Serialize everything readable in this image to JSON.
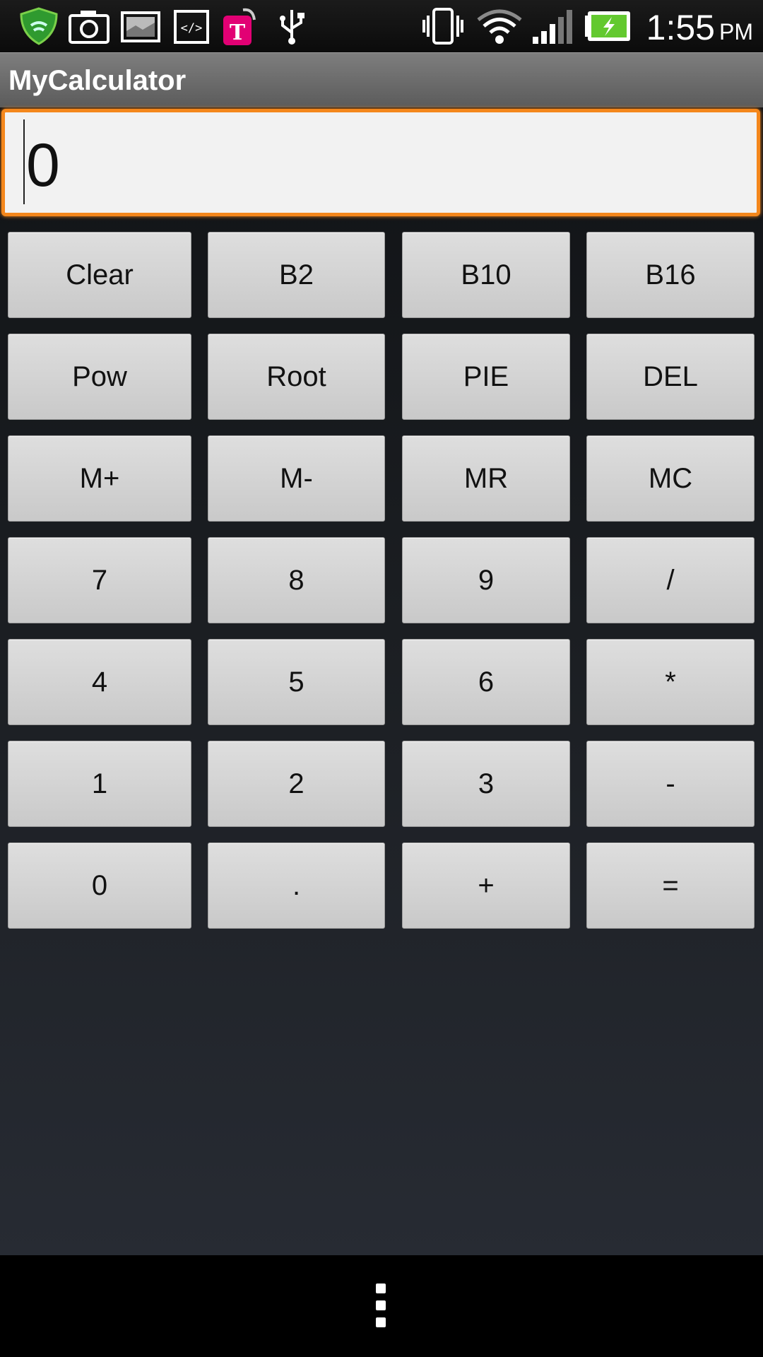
{
  "status_bar": {
    "icons": [
      "lookout-shield-icon",
      "camera-icon",
      "gallery-icon",
      "code-icon",
      "tmobile-tag-icon",
      "usb-icon",
      "vibrate-icon",
      "wifi-icon",
      "signal-icon",
      "battery-charging-icon"
    ],
    "time": "1:55",
    "ampm": "PM"
  },
  "action_bar": {
    "title": "MyCalculator"
  },
  "display": {
    "value": "0"
  },
  "keypad": {
    "rows": [
      [
        "Clear",
        "B2",
        "B10",
        "B16"
      ],
      [
        "Pow",
        "Root",
        "PIE",
        "DEL"
      ],
      [
        "M+",
        "M-",
        "MR",
        "MC"
      ],
      [
        "7",
        "8",
        "9",
        "/"
      ],
      [
        "4",
        "5",
        "6",
        "*"
      ],
      [
        "1",
        "2",
        "3",
        "-"
      ],
      [
        "0",
        ".",
        "+",
        "="
      ]
    ]
  },
  "nav_bar": {
    "icons": [
      "menu-overflow-icon"
    ]
  },
  "colors": {
    "accent": "#f4871c",
    "display_bg": "#f2f2f2",
    "key_bg": "#d6d6d6"
  }
}
